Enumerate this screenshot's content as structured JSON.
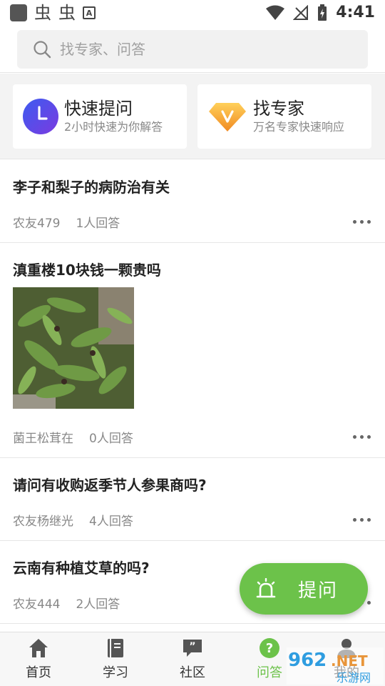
{
  "status_bar": {
    "time": "4:41",
    "glyph1": "虫",
    "glyph2": "虫",
    "a_badge": "A"
  },
  "search": {
    "placeholder": "找专家、问答"
  },
  "quick": {
    "ask": {
      "title": "快速提问",
      "subtitle": "2小时快速为你解答",
      "icon": "clock-icon",
      "color": "#5a48e6"
    },
    "expert": {
      "title": "找专家",
      "subtitle": "万名专家快速响应",
      "icon": "diamond-v-icon",
      "color": "#f3a33a"
    }
  },
  "feed": [
    {
      "title": "李子和梨子的病防治有关",
      "author": "农友479",
      "answers": "1人回答"
    },
    {
      "title": "滇重楼10块钱一颗贵吗",
      "author": "菌王松茸在",
      "answers": "0人回答",
      "has_photo": true
    },
    {
      "title": "请问有收购返季节人参果商吗?",
      "author": "农友杨继光",
      "answers": "4人回答"
    },
    {
      "title": "云南有种植艾草的吗?",
      "author": "农友444",
      "answers": "2人回答"
    }
  ],
  "fab": {
    "label": "提问",
    "color": "#6cc24a"
  },
  "nav": [
    {
      "label": "首页",
      "icon": "home-icon"
    },
    {
      "label": "学习",
      "icon": "book-icon"
    },
    {
      "label": "社区",
      "icon": "chat-quote-icon"
    },
    {
      "label": "问答",
      "icon": "question-icon",
      "active": true
    },
    {
      "label": "我的",
      "icon": "person-icon"
    }
  ],
  "watermark": {
    "brand": "962",
    "suffix": ".NET",
    "subtitle": "乐游网"
  }
}
